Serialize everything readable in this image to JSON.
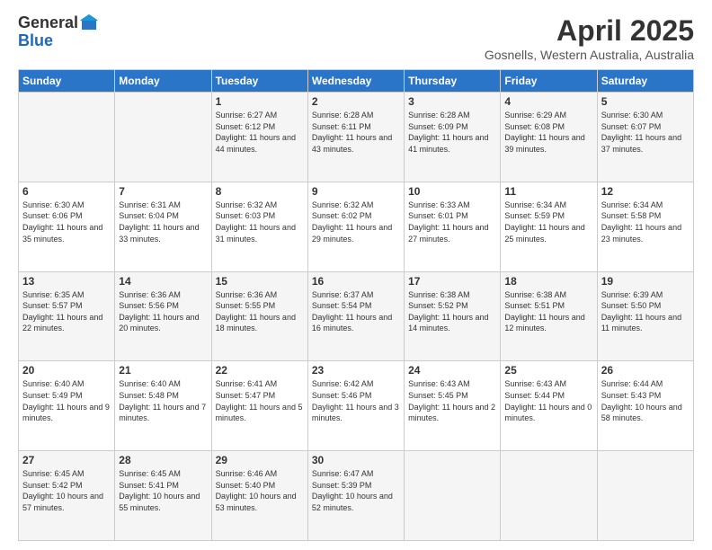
{
  "header": {
    "logo_general": "General",
    "logo_blue": "Blue",
    "month_title": "April 2025",
    "location": "Gosnells, Western Australia, Australia"
  },
  "days_of_week": [
    "Sunday",
    "Monday",
    "Tuesday",
    "Wednesday",
    "Thursday",
    "Friday",
    "Saturday"
  ],
  "weeks": [
    [
      {
        "day": "",
        "info": ""
      },
      {
        "day": "",
        "info": ""
      },
      {
        "day": "1",
        "info": "Sunrise: 6:27 AM\nSunset: 6:12 PM\nDaylight: 11 hours and 44 minutes."
      },
      {
        "day": "2",
        "info": "Sunrise: 6:28 AM\nSunset: 6:11 PM\nDaylight: 11 hours and 43 minutes."
      },
      {
        "day": "3",
        "info": "Sunrise: 6:28 AM\nSunset: 6:09 PM\nDaylight: 11 hours and 41 minutes."
      },
      {
        "day": "4",
        "info": "Sunrise: 6:29 AM\nSunset: 6:08 PM\nDaylight: 11 hours and 39 minutes."
      },
      {
        "day": "5",
        "info": "Sunrise: 6:30 AM\nSunset: 6:07 PM\nDaylight: 11 hours and 37 minutes."
      }
    ],
    [
      {
        "day": "6",
        "info": "Sunrise: 6:30 AM\nSunset: 6:06 PM\nDaylight: 11 hours and 35 minutes."
      },
      {
        "day": "7",
        "info": "Sunrise: 6:31 AM\nSunset: 6:04 PM\nDaylight: 11 hours and 33 minutes."
      },
      {
        "day": "8",
        "info": "Sunrise: 6:32 AM\nSunset: 6:03 PM\nDaylight: 11 hours and 31 minutes."
      },
      {
        "day": "9",
        "info": "Sunrise: 6:32 AM\nSunset: 6:02 PM\nDaylight: 11 hours and 29 minutes."
      },
      {
        "day": "10",
        "info": "Sunrise: 6:33 AM\nSunset: 6:01 PM\nDaylight: 11 hours and 27 minutes."
      },
      {
        "day": "11",
        "info": "Sunrise: 6:34 AM\nSunset: 5:59 PM\nDaylight: 11 hours and 25 minutes."
      },
      {
        "day": "12",
        "info": "Sunrise: 6:34 AM\nSunset: 5:58 PM\nDaylight: 11 hours and 23 minutes."
      }
    ],
    [
      {
        "day": "13",
        "info": "Sunrise: 6:35 AM\nSunset: 5:57 PM\nDaylight: 11 hours and 22 minutes."
      },
      {
        "day": "14",
        "info": "Sunrise: 6:36 AM\nSunset: 5:56 PM\nDaylight: 11 hours and 20 minutes."
      },
      {
        "day": "15",
        "info": "Sunrise: 6:36 AM\nSunset: 5:55 PM\nDaylight: 11 hours and 18 minutes."
      },
      {
        "day": "16",
        "info": "Sunrise: 6:37 AM\nSunset: 5:54 PM\nDaylight: 11 hours and 16 minutes."
      },
      {
        "day": "17",
        "info": "Sunrise: 6:38 AM\nSunset: 5:52 PM\nDaylight: 11 hours and 14 minutes."
      },
      {
        "day": "18",
        "info": "Sunrise: 6:38 AM\nSunset: 5:51 PM\nDaylight: 11 hours and 12 minutes."
      },
      {
        "day": "19",
        "info": "Sunrise: 6:39 AM\nSunset: 5:50 PM\nDaylight: 11 hours and 11 minutes."
      }
    ],
    [
      {
        "day": "20",
        "info": "Sunrise: 6:40 AM\nSunset: 5:49 PM\nDaylight: 11 hours and 9 minutes."
      },
      {
        "day": "21",
        "info": "Sunrise: 6:40 AM\nSunset: 5:48 PM\nDaylight: 11 hours and 7 minutes."
      },
      {
        "day": "22",
        "info": "Sunrise: 6:41 AM\nSunset: 5:47 PM\nDaylight: 11 hours and 5 minutes."
      },
      {
        "day": "23",
        "info": "Sunrise: 6:42 AM\nSunset: 5:46 PM\nDaylight: 11 hours and 3 minutes."
      },
      {
        "day": "24",
        "info": "Sunrise: 6:43 AM\nSunset: 5:45 PM\nDaylight: 11 hours and 2 minutes."
      },
      {
        "day": "25",
        "info": "Sunrise: 6:43 AM\nSunset: 5:44 PM\nDaylight: 11 hours and 0 minutes."
      },
      {
        "day": "26",
        "info": "Sunrise: 6:44 AM\nSunset: 5:43 PM\nDaylight: 10 hours and 58 minutes."
      }
    ],
    [
      {
        "day": "27",
        "info": "Sunrise: 6:45 AM\nSunset: 5:42 PM\nDaylight: 10 hours and 57 minutes."
      },
      {
        "day": "28",
        "info": "Sunrise: 6:45 AM\nSunset: 5:41 PM\nDaylight: 10 hours and 55 minutes."
      },
      {
        "day": "29",
        "info": "Sunrise: 6:46 AM\nSunset: 5:40 PM\nDaylight: 10 hours and 53 minutes."
      },
      {
        "day": "30",
        "info": "Sunrise: 6:47 AM\nSunset: 5:39 PM\nDaylight: 10 hours and 52 minutes."
      },
      {
        "day": "",
        "info": ""
      },
      {
        "day": "",
        "info": ""
      },
      {
        "day": "",
        "info": ""
      }
    ]
  ]
}
